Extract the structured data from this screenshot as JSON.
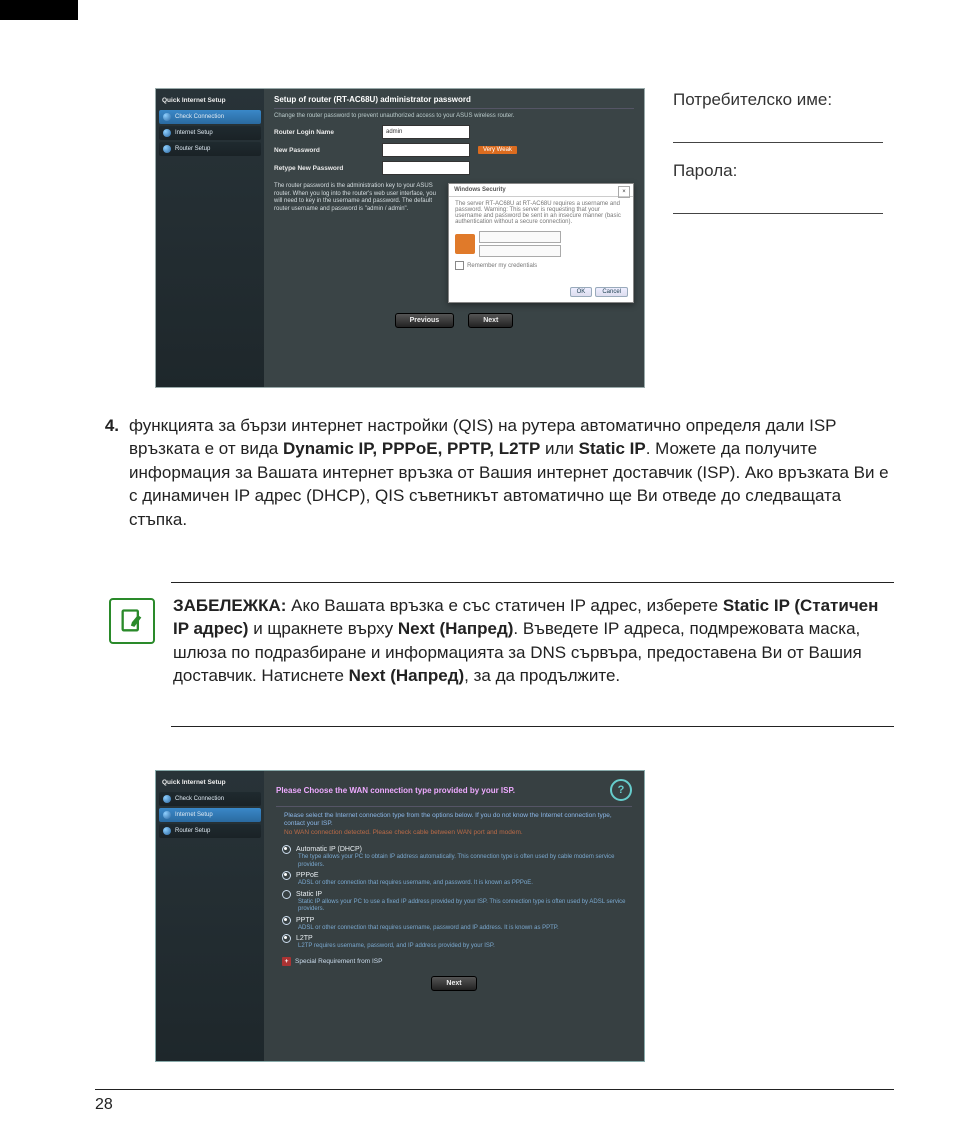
{
  "page_number": "28",
  "credentials": {
    "username_label": "Потребителско име:",
    "password_label": "Парола:"
  },
  "step4": {
    "number": "4.",
    "part1": "функцията за бързи интернет настройки (QIS) на рутера автоматично определя дали ISP връзката е от вида ",
    "bold1": "Dynamic IP, PPPoE, PPTP, L2TP",
    "part2": " или ",
    "bold2": "Static IP",
    "part3": ". Можете да получите информация за Вашата интернет връзка от Вашия интернет доставчик (ISP). Ако връзката Ви е с динамичен IP адрес (DHCP), QIS съветникът автоматично ще Ви отведе до следващата стъпка."
  },
  "note": {
    "label": "ЗАБЕЛЕЖКА:",
    "part1": " Ако Вашата връзка е със статичен IP адрес, изберете ",
    "bold1": "Static IP (Статичен IP адрес)",
    "part2": " и щракнете върху ",
    "bold2": "Next (Напред)",
    "part3": ". Въведете IP адреса, подмрежовата маска, шлюза по подразбиране и информацията за DNS сървъра, предоставена Ви от Вашия доставчик. Натиснете ",
    "bold3": "Next (Напред)",
    "part4": ", за да продължите."
  },
  "shot1": {
    "sidebar_title": "Quick Internet Setup",
    "steps": [
      "Check Connection",
      "Internet Setup",
      "Router Setup"
    ],
    "heading": "Setup of router (RT-AC68U) administrator password",
    "sub": "Change the router password to prevent unauthorized access to your ASUS wireless router.",
    "fields": {
      "login_label": "Router Login Name",
      "login_value": "admin",
      "newpass_label": "New Password",
      "retype_label": "Retype New Password",
      "weak": "Very Weak"
    },
    "info_text": "The router password is the administration key to your ASUS router. When you log into the router's web user interface, you will need to key in the username and password. The default router username and password is \"admin / admin\".",
    "popup": {
      "title": "Windows Security",
      "body": "The server RT-AC68U at RT-AC68U requires a username and password. Warning: This server is requesting that your username and password be sent in an insecure manner (basic authentication without a secure connection).",
      "remember": "Remember my credentials",
      "ok": "OK",
      "cancel": "Cancel"
    },
    "prev": "Previous",
    "next": "Next"
  },
  "shot2": {
    "sidebar_title": "Quick Internet Setup",
    "steps": [
      "Check Connection",
      "Internet Setup",
      "Router Setup"
    ],
    "title": "Please Choose the WAN connection type provided by your ISP.",
    "intro1": "Please select the Internet connection type from the options below. If you do not know the Internet connection type, contact your ISP.",
    "intro2": "No WAN connection detected. Please check cable between WAN port and modem.",
    "options": [
      {
        "name": "Automatic IP (DHCP)",
        "desc": "The type allows your PC to obtain IP address automatically. This connection type is often used by cable modem service providers."
      },
      {
        "name": "PPPoE",
        "desc": "ADSL or other connection that requires username, and password. It is known as PPPoE."
      },
      {
        "name": "Static IP",
        "desc": "Static IP allows your PC to use a fixed IP address provided by your ISP. This connection type is often used by ADSL service providers."
      },
      {
        "name": "PPTP",
        "desc": "ADSL or other connection that requires username, password and IP address. It is known as PPTP."
      },
      {
        "name": "L2TP",
        "desc": "L2TP requires username, password, and IP address provided by your ISP."
      }
    ],
    "special": "Special Requirement from ISP",
    "next": "Next"
  }
}
